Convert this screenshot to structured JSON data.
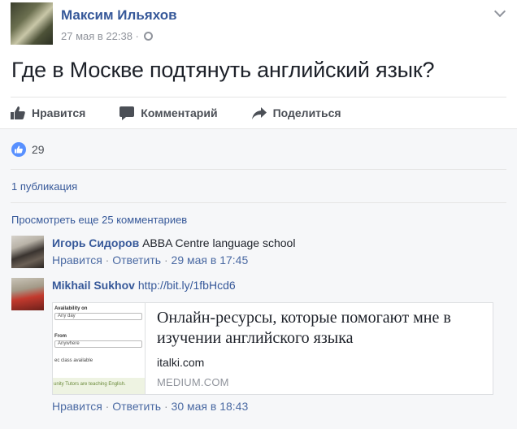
{
  "post": {
    "author": "Максим Ильяхов",
    "date": "27 мая в 22:38 ·",
    "text": "Где в Москве подтянуть английский язык?"
  },
  "actions": [
    {
      "label": "Нравится",
      "icon": "thumb-up-icon"
    },
    {
      "label": "Комментарий",
      "icon": "comment-icon"
    },
    {
      "label": "Поделиться",
      "icon": "share-icon"
    }
  ],
  "likes": {
    "count": "29",
    "color": "#5890ff"
  },
  "publication": "1 публикация",
  "more_comments": "Просмотреть еще 25 комментариев",
  "comments": [
    {
      "author": "Игорь Сидоров",
      "text": "ABBA Centre language school",
      "like": "Нравится",
      "reply": "Ответить",
      "date": "29 мая в 17:45"
    },
    {
      "author": "Mikhail Sukhov",
      "link": "http://bit.ly/1fbHcd6",
      "like": "Нравится",
      "reply": "Ответить",
      "date": "30 мая в 18:43",
      "card": {
        "title": "Онлайн-ресурсы, которые помогают мне в изучении английского языка",
        "domain": "italki.com",
        "source": "MEDIUM.COM",
        "thumb": {
          "label1": "Availability on",
          "select1": "Any day",
          "label2": "From",
          "select2": "Anywhere",
          "note": "ec class available",
          "footer": "unity Tutors are teaching English."
        }
      }
    }
  ],
  "separator": "·",
  "colors": {
    "link": "#365899",
    "muted": "#90949c",
    "background": "#f6f7f9"
  }
}
